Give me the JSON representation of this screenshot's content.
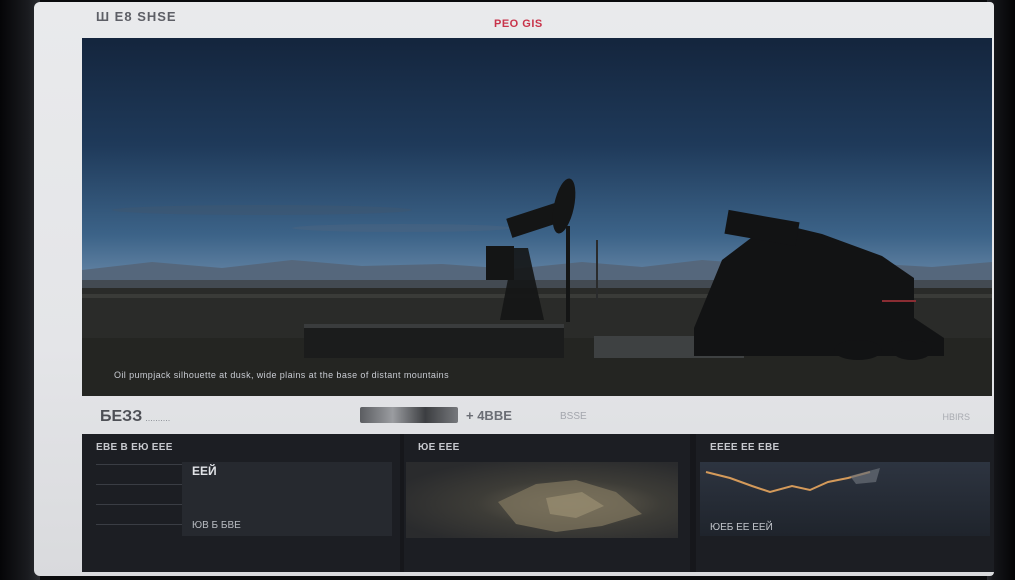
{
  "header": {
    "logo_text": "Ш E8 SHSE",
    "title": "PEO GIS"
  },
  "hero": {
    "caption": "Oil pumpjack silhouette at dusk, wide plains at the base of distant mountains"
  },
  "infobar": {
    "price": "БЕЗЗ",
    "price_unit": "..........",
    "chart_label": "+ 4BBE",
    "chart_sub": "BSSE",
    "right_text": "HBIRS"
  },
  "panels": {
    "left": {
      "title": "ЕВЕ В ЕЮ ЕЕЕ",
      "big_value": "ЕЕЙ",
      "footer": "ЮВ Б   БВЕ"
    },
    "middle": {
      "title": "ЮЕ ЕЕЕ"
    },
    "right": {
      "title": "ЕЕЕЕ ЕЕ ЕВЕ",
      "footer": "ЮЕБ ЕЕ ЕЕЙ"
    }
  },
  "colors": {
    "title_accent": "#c8334a",
    "route_line": "#d49a5a",
    "panel_bg": "#1c1e23"
  }
}
